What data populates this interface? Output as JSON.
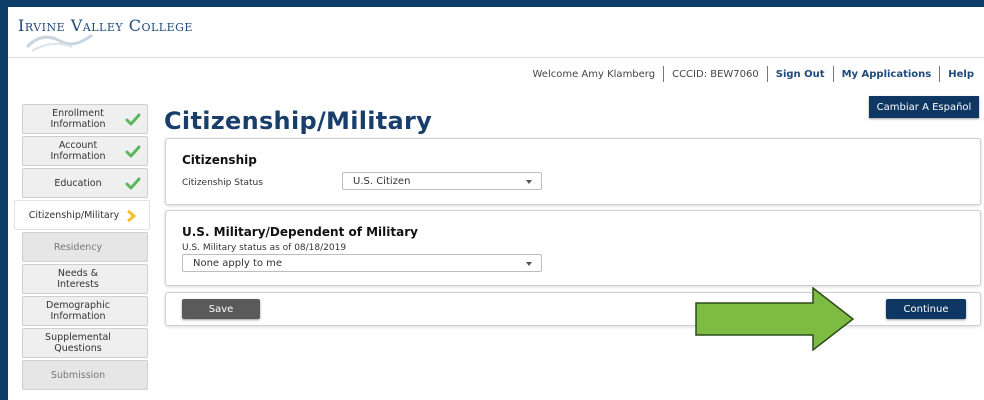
{
  "header": {
    "college_name": "Irvine Valley College"
  },
  "topnav": {
    "welcome": "Welcome Amy Klamberg",
    "ccid": "CCCID: BEW7060",
    "sign_out": "Sign Out",
    "my_applications": "My Applications",
    "help": "Help"
  },
  "language_button": "Cambiar A Español",
  "page_title": "Citizenship/Military",
  "sidebar": {
    "items": [
      {
        "label": "Enrollment Information",
        "state": "complete"
      },
      {
        "label": "Account Information",
        "state": "complete"
      },
      {
        "label": "Education",
        "state": "complete"
      },
      {
        "label": "Citizenship/Military",
        "state": "active"
      },
      {
        "label": "Residency",
        "state": "disabled"
      },
      {
        "label": "Needs & Interests",
        "state": "enabled"
      },
      {
        "label": "Demographic Information",
        "state": "enabled"
      },
      {
        "label": "Supplemental Questions",
        "state": "enabled"
      },
      {
        "label": "Submission",
        "state": "disabled"
      }
    ]
  },
  "citizenship": {
    "heading": "Citizenship",
    "status_label": "Citizenship Status",
    "status_value": "U.S. Citizen"
  },
  "military": {
    "heading": "U.S. Military/Dependent of Military",
    "status_label": "U.S. Military status as of 08/18/2019",
    "status_value": "None apply to me"
  },
  "actions": {
    "save": "Save",
    "continue": "Continue"
  },
  "colors": {
    "brand_navy": "#0f3763",
    "check_green": "#5cb85c",
    "arrow_yellow": "#f2c12e",
    "callout_arrow": "#7dbb42"
  },
  "icons": {
    "complete": "check-icon",
    "active": "chevron-right-icon",
    "dropdown": "chevron-down-icon",
    "callout": "arrow-right-icon"
  }
}
